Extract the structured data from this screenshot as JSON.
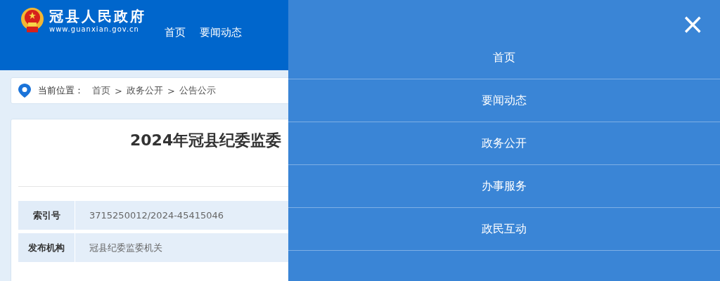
{
  "header": {
    "site_name": "冠县人民政府",
    "site_url": "www.guanxian.gov.cn",
    "nav": [
      {
        "label": "首页"
      },
      {
        "label": "要闻动态"
      }
    ]
  },
  "breadcrumb": {
    "label": "当前位置：",
    "separator": ">",
    "items": [
      "首页",
      "政务公开",
      "公告公示"
    ]
  },
  "article": {
    "title": "2024年冠县纪委监委",
    "meta": [
      {
        "label": "索引号",
        "value": "3715250012/2024-45415046"
      },
      {
        "label": "发布机构",
        "value": "冠县纪委监委机关"
      }
    ]
  },
  "menu_panel": {
    "close": "×",
    "items": [
      {
        "label": "首页"
      },
      {
        "label": "要闻动态"
      },
      {
        "label": "政务公开"
      },
      {
        "label": "办事服务"
      },
      {
        "label": "政民互动"
      }
    ]
  }
}
